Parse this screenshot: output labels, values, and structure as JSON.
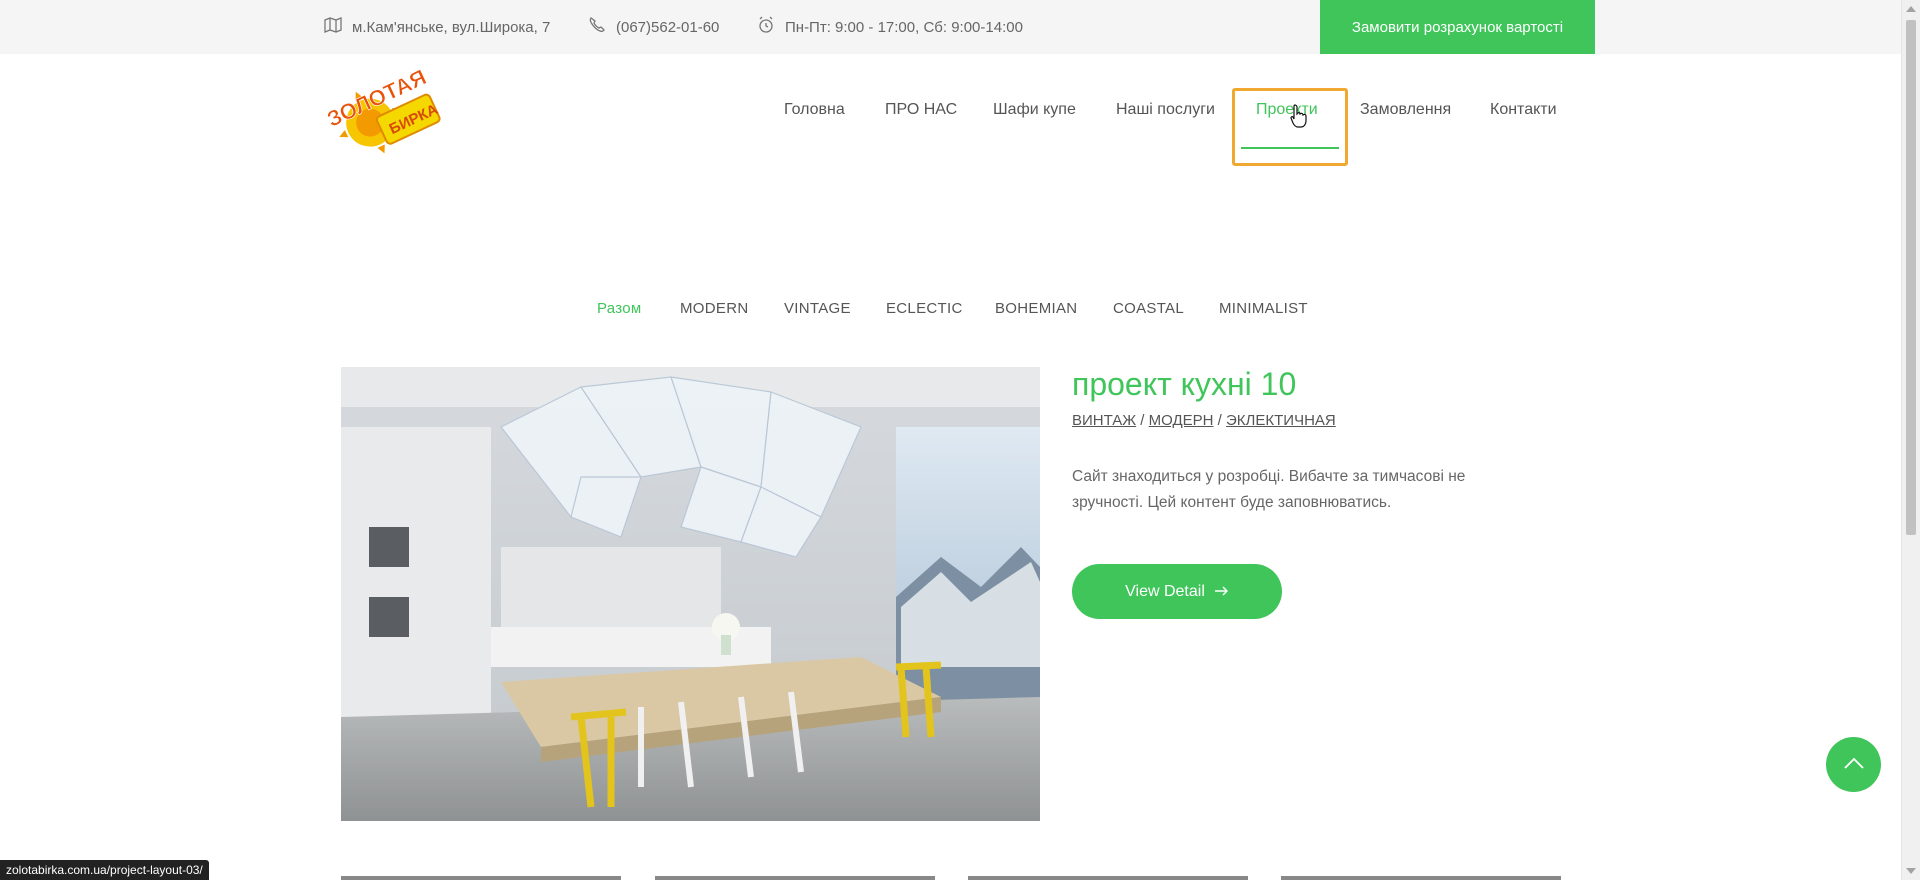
{
  "topbar": {
    "address": "м.Кам'янське, вул.Широка, 7",
    "phone": "(067)562-01-60",
    "hours": "Пн-Пт: 9:00 - 17:00, Сб: 9:00-14:00",
    "cta_label": "Замовити розрахунок вартості"
  },
  "logo": {
    "icon": "logo-image",
    "text": "ЗОЛОТАЯ БИРКА"
  },
  "nav": {
    "items": [
      {
        "label": "Головна"
      },
      {
        "label": "ПРО НАС"
      },
      {
        "label": "Шафи купе"
      },
      {
        "label": "Наші послуги"
      },
      {
        "label": "Проекти"
      },
      {
        "label": "Замовлення"
      },
      {
        "label": "Контакти"
      }
    ],
    "active": "Проекти"
  },
  "filters": {
    "items": [
      {
        "label": "Разом"
      },
      {
        "label": "MODERN"
      },
      {
        "label": "VINTAGE"
      },
      {
        "label": "ECLECTIC"
      },
      {
        "label": "BOHEMIAN"
      },
      {
        "label": "COASTAL"
      },
      {
        "label": "MINIMALIST"
      }
    ],
    "active": "Разом"
  },
  "project": {
    "title": "проект кухні 10",
    "tags": [
      "ВИНТАЖ",
      "МОДЕРН",
      "ЭКЛЕКТИЧНАЯ"
    ],
    "tag_sep": " / ",
    "description": "Сайт знаходиться у розробці. Вибачте за тимчасові не зручності. Цей контент буде заповнюватись.",
    "button_label": "View Detail",
    "image": "kitchen-dining-photo"
  },
  "status_url": "zolotabirka.com.ua/project-layout-03/",
  "colors": {
    "accent": "#3fc55a",
    "topbar_bg": "#f5f5f5",
    "focus": "#f0a830"
  }
}
